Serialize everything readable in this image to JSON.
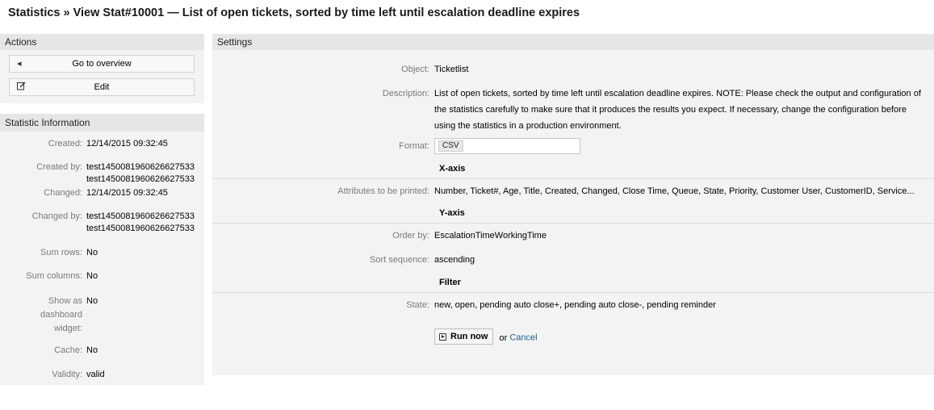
{
  "page": {
    "title": "Statistics » View Stat#10001 — List of open tickets, sorted by time left until escalation deadline expires"
  },
  "sidebar": {
    "actions_title": "Actions",
    "actions": [
      {
        "label": "Go to overview",
        "icon": "caret-left-icon"
      },
      {
        "label": "Edit",
        "icon": "edit-icon"
      }
    ],
    "info_title": "Statistic Information",
    "info": [
      {
        "label": "Created:",
        "value": [
          "12/14/2015 09:32:45"
        ]
      },
      {
        "label": "Created by:",
        "value": [
          "test1450081960626627533",
          "test1450081960626627533"
        ]
      },
      {
        "label": "Changed:",
        "value": [
          "12/14/2015 09:32:45"
        ]
      },
      {
        "label": "Changed by:",
        "value": [
          "test1450081960626627533",
          "test1450081960626627533"
        ]
      },
      {
        "label": "Sum rows:",
        "value": [
          "No"
        ]
      },
      {
        "label": "Sum columns:",
        "value": [
          "No"
        ]
      },
      {
        "label": "Show as dashboard widget:",
        "value": [
          "No"
        ]
      },
      {
        "label": "Cache:",
        "value": [
          "No"
        ]
      },
      {
        "label": "Validity:",
        "value": [
          "valid"
        ]
      }
    ]
  },
  "settings": {
    "title": "Settings",
    "object_label": "Object:",
    "object_value": "Ticketlist",
    "description_label": "Description:",
    "description_value": "List of open tickets, sorted by time left until escalation deadline expires. NOTE: Please check the output and configuration of the statistics carefully to make sure that it produces the results you expect. If necessary, change the configuration before using the statistics in a production environment.",
    "format_label": "Format:",
    "format_value": "CSV",
    "xaxis_title": "X-axis",
    "attributes_label": "Attributes to be printed:",
    "attributes_value": "Number, Ticket#, Age, Title, Created, Changed, Close Time, Queue, State, Priority, Customer User, CustomerID, Service...",
    "yaxis_title": "Y-axis",
    "orderby_label": "Order by:",
    "orderby_value": "EscalationTimeWorkingTime",
    "sortseq_label": "Sort sequence:",
    "sortseq_value": "ascending",
    "filter_title": "Filter",
    "state_label": "State:",
    "state_value": "new, open, pending auto close+, pending auto close-, pending reminder",
    "run_label": "Run now",
    "or_text": "or",
    "cancel_label": "Cancel"
  },
  "colors": {
    "header_bg": "#e6e6e6",
    "panel_bg": "#f3f3f3",
    "link": "#1f5f8b"
  }
}
